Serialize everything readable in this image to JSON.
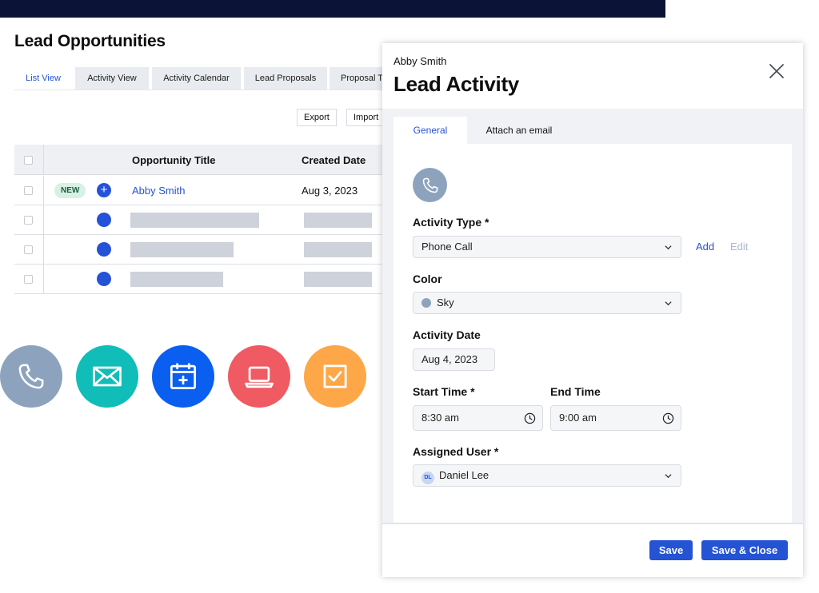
{
  "page": {
    "title": "Lead Opportunities",
    "tabs": [
      {
        "label": "List View"
      },
      {
        "label": "Activity View"
      },
      {
        "label": "Activity Calendar"
      },
      {
        "label": "Lead Proposals"
      },
      {
        "label": "Proposal T"
      }
    ],
    "toolbar": {
      "export_label": "Export",
      "import_label": "Import"
    }
  },
  "table": {
    "columns": [
      "Opportunity Title",
      "Created Date"
    ],
    "rows": [
      {
        "badge": "NEW",
        "title": "Abby Smith",
        "created": "Aug 3, 2023"
      }
    ]
  },
  "activity_types": [
    {
      "icon": "phone-icon",
      "color": "#8da3bd"
    },
    {
      "icon": "envelope-icon",
      "color": "#10bdb8"
    },
    {
      "icon": "calendar-plus-icon",
      "color": "#0a5ef0"
    },
    {
      "icon": "laptop-icon",
      "color": "#ef5a63"
    },
    {
      "icon": "checkbox-icon",
      "color": "#fda748"
    }
  ],
  "panel": {
    "subtitle": "Abby Smith",
    "title": "Lead Activity",
    "tabs": {
      "general": "General",
      "attach": "Attach an email"
    },
    "form": {
      "activity_type": {
        "label": "Activity Type *",
        "value": "Phone Call",
        "add": "Add",
        "edit": "Edit"
      },
      "color": {
        "label": "Color",
        "value": "Sky",
        "swatch": "#8da3bd"
      },
      "activity_date": {
        "label": "Activity Date",
        "value": "Aug 4, 2023"
      },
      "start_time": {
        "label": "Start Time *",
        "value": "8:30 am"
      },
      "end_time": {
        "label": "End Time",
        "value": "9:00 am"
      },
      "assigned_user": {
        "label": "Assigned User *",
        "initials": "DL",
        "value": "Daniel Lee"
      }
    },
    "footer": {
      "save": "Save",
      "save_close": "Save & Close"
    }
  },
  "colors": {
    "accent": "#2453d4",
    "topbar": "#0b1437",
    "new_badge_bg": "#d7f1e4"
  }
}
